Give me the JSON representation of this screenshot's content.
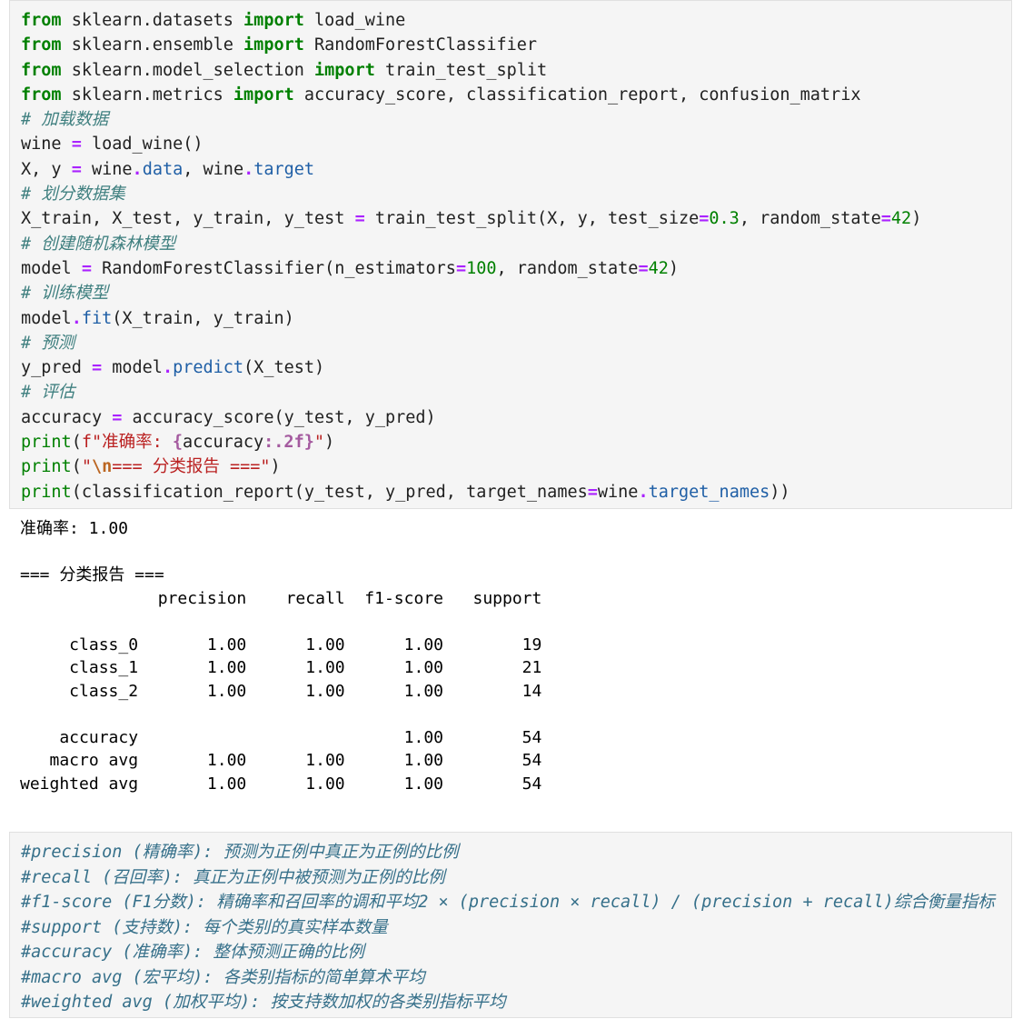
{
  "code_cell": {
    "lines": [
      [
        {
          "t": "kw",
          "v": "from"
        },
        {
          "t": "p",
          "v": " sklearn.datasets "
        },
        {
          "t": "kw",
          "v": "import"
        },
        {
          "t": "p",
          "v": " load_wine"
        }
      ],
      [
        {
          "t": "kw",
          "v": "from"
        },
        {
          "t": "p",
          "v": " sklearn.ensemble "
        },
        {
          "t": "kw",
          "v": "import"
        },
        {
          "t": "p",
          "v": " RandomForestClassifier"
        }
      ],
      [
        {
          "t": "kw",
          "v": "from"
        },
        {
          "t": "p",
          "v": " sklearn.model_selection "
        },
        {
          "t": "kw",
          "v": "import"
        },
        {
          "t": "p",
          "v": " train_test_split"
        }
      ],
      [
        {
          "t": "kw",
          "v": "from"
        },
        {
          "t": "p",
          "v": " sklearn.metrics "
        },
        {
          "t": "kw",
          "v": "import"
        },
        {
          "t": "p",
          "v": " accuracy_score, classification_report, confusion_matrix"
        }
      ],
      [
        {
          "t": "cm",
          "v": "# 加载数据"
        }
      ],
      [
        {
          "t": "p",
          "v": "wine "
        },
        {
          "t": "op",
          "v": "="
        },
        {
          "t": "p",
          "v": " load_wine()"
        }
      ],
      [
        {
          "t": "p",
          "v": "X, y "
        },
        {
          "t": "op",
          "v": "="
        },
        {
          "t": "p",
          "v": " wine"
        },
        {
          "t": "op",
          "v": "."
        },
        {
          "t": "attr",
          "v": "data"
        },
        {
          "t": "p",
          "v": ", wine"
        },
        {
          "t": "op",
          "v": "."
        },
        {
          "t": "attr",
          "v": "target"
        }
      ],
      [
        {
          "t": "cm",
          "v": "# 划分数据集"
        }
      ],
      [
        {
          "t": "p",
          "v": "X_train, X_test, y_train, y_test "
        },
        {
          "t": "op",
          "v": "="
        },
        {
          "t": "p",
          "v": " train_test_split(X, y, test_size"
        },
        {
          "t": "op",
          "v": "="
        },
        {
          "t": "num",
          "v": "0.3"
        },
        {
          "t": "p",
          "v": ", random_state"
        },
        {
          "t": "op",
          "v": "="
        },
        {
          "t": "num",
          "v": "42"
        },
        {
          "t": "p",
          "v": ")"
        }
      ],
      [
        {
          "t": "cm",
          "v": "# 创建随机森林模型"
        }
      ],
      [
        {
          "t": "p",
          "v": "model "
        },
        {
          "t": "op",
          "v": "="
        },
        {
          "t": "p",
          "v": " RandomForestClassifier(n_estimators"
        },
        {
          "t": "op",
          "v": "="
        },
        {
          "t": "num",
          "v": "100"
        },
        {
          "t": "p",
          "v": ", random_state"
        },
        {
          "t": "op",
          "v": "="
        },
        {
          "t": "num",
          "v": "42"
        },
        {
          "t": "p",
          "v": ")"
        }
      ],
      [
        {
          "t": "cm",
          "v": "# 训练模型"
        }
      ],
      [
        {
          "t": "p",
          "v": "model"
        },
        {
          "t": "op",
          "v": "."
        },
        {
          "t": "attr",
          "v": "fit"
        },
        {
          "t": "p",
          "v": "(X_train, y_train)"
        }
      ],
      [
        {
          "t": "cm",
          "v": "# 预测"
        }
      ],
      [
        {
          "t": "p",
          "v": "y_pred "
        },
        {
          "t": "op",
          "v": "="
        },
        {
          "t": "p",
          "v": " model"
        },
        {
          "t": "op",
          "v": "."
        },
        {
          "t": "attr",
          "v": "predict"
        },
        {
          "t": "p",
          "v": "(X_test)"
        }
      ],
      [
        {
          "t": "cm",
          "v": "# 评估"
        }
      ],
      [
        {
          "t": "p",
          "v": "accuracy "
        },
        {
          "t": "op",
          "v": "="
        },
        {
          "t": "p",
          "v": " accuracy_score(y_test, y_pred)"
        }
      ],
      [
        {
          "t": "fn",
          "v": "print"
        },
        {
          "t": "p",
          "v": "("
        },
        {
          "t": "str",
          "v": "f\"准确率: "
        },
        {
          "t": "fmt",
          "v": "{"
        },
        {
          "t": "p",
          "v": "accuracy"
        },
        {
          "t": "fmt",
          "v": ":.2f}"
        },
        {
          "t": "str",
          "v": "\""
        },
        {
          "t": "p",
          "v": ")"
        }
      ],
      [
        {
          "t": "fn",
          "v": "print"
        },
        {
          "t": "p",
          "v": "("
        },
        {
          "t": "str",
          "v": "\""
        },
        {
          "t": "esc",
          "v": "\\n"
        },
        {
          "t": "str",
          "v": "=== 分类报告 ===\""
        },
        {
          "t": "p",
          "v": ")"
        }
      ],
      [
        {
          "t": "fn",
          "v": "print"
        },
        {
          "t": "p",
          "v": "(classification_report(y_test, y_pred, target_names"
        },
        {
          "t": "op",
          "v": "="
        },
        {
          "t": "p",
          "v": "wine"
        },
        {
          "t": "op",
          "v": "."
        },
        {
          "t": "attr",
          "v": "target_names"
        },
        {
          "t": "p",
          "v": "))"
        }
      ]
    ]
  },
  "output": {
    "lines": [
      "准确率: 1.00",
      "",
      "=== 分类报告 ===",
      "              precision    recall  f1-score   support",
      "",
      "     class_0       1.00      1.00      1.00        19",
      "     class_1       1.00      1.00      1.00        21",
      "     class_2       1.00      1.00      1.00        14",
      "",
      "    accuracy                           1.00        54",
      "   macro avg       1.00      1.00      1.00        54",
      "weighted avg       1.00      1.00      1.00        54"
    ]
  },
  "markdown_cell": {
    "lines": [
      "#precision (精确率): 预测为正例中真正为正例的比例",
      "#recall (召回率): 真正为正例中被预测为正例的比例",
      "#f1-score (F1分数): 精确率和召回率的调和平均2 × (precision × recall) / (precision + recall)综合衡量指标",
      "#support (支持数): 每个类别的真实样本数量",
      "#accuracy (准确率): 整体预测正确的比例",
      "#macro avg (宏平均): 各类别指标的简单算术平均",
      "#weighted avg (加权平均): 按支持数加权的各类别指标平均"
    ]
  }
}
